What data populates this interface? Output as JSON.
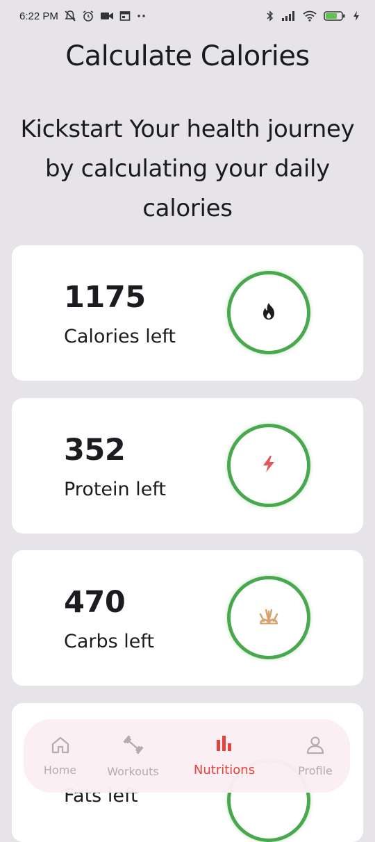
{
  "status_bar": {
    "time": "6:22 PM",
    "battery": "68"
  },
  "header": {
    "title": "Calculate Calories",
    "subtitle_lines": [
      "Kickstart Your health journey",
      "by calculating your daily",
      "calories"
    ]
  },
  "cards": [
    {
      "value": "1175",
      "label": "Calories left",
      "icon": "flame-icon",
      "icon_color": "#1c1b20"
    },
    {
      "value": "352",
      "label": "Protein left",
      "icon": "lightning-icon",
      "icon_color": "#e2585a"
    },
    {
      "value": "470",
      "label": "Carbs left",
      "icon": "wheat-icon",
      "icon_color": "#d9a26b"
    },
    {
      "value": "",
      "label": "Fats left",
      "icon": "",
      "icon_color": ""
    }
  ],
  "nav": {
    "items": [
      {
        "label": "Home",
        "icon": "home-icon"
      },
      {
        "label": "Workouts",
        "icon": "dumbbell-icon"
      },
      {
        "label": "Nutritions",
        "icon": "bar-chart-icon"
      },
      {
        "label": "Profile",
        "icon": "person-icon"
      }
    ],
    "active": "Nutritions"
  },
  "colors": {
    "ring": "#49a84d",
    "active_nav": "#e2443b",
    "inactive_nav": "#b2acb2",
    "background": "#e6e4e8"
  }
}
